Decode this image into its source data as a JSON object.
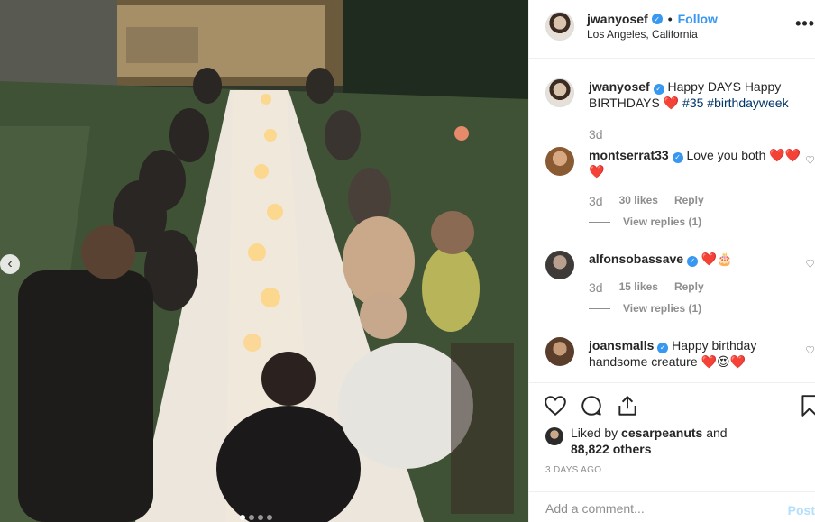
{
  "post": {
    "username": "jwanyosef",
    "follow_label": "Follow",
    "separator": "•",
    "location": "Los Angeles, California",
    "more_label": "•••"
  },
  "caption": {
    "username": "jwanyosef",
    "text_before": "Happy DAYS Happy BIRTHDAYS ❤️",
    "hashtags": "#35 #birthdayweek",
    "time": "3d"
  },
  "comments": [
    {
      "username": "montserrat33",
      "text": "Love you both ❤️❤️❤️",
      "time": "3d",
      "likes": "30 likes",
      "reply": "Reply",
      "view_replies": "View replies (1)"
    },
    {
      "username": "alfonsobassave",
      "text": "❤️🎂",
      "time": "3d",
      "likes": "15 likes",
      "reply": "Reply",
      "view_replies": "View replies (1)"
    },
    {
      "username": "joansmalls",
      "text": "Happy birthday handsome creature ❤️😍❤️"
    }
  ],
  "likes": {
    "prefix": "Liked by",
    "user": "cesarpeanuts",
    "joiner": "and",
    "others": "88,822 others"
  },
  "date": "3 DAYS AGO",
  "add_comment": {
    "placeholder": "Add a comment...",
    "post_label": "Post"
  },
  "carousel": {
    "prev_icon": "‹",
    "dot_count": 4,
    "active_index": 0
  },
  "colors": {
    "accent": "#3897f0",
    "text": "#262626",
    "muted": "#8e8e8e",
    "border": "#efefef",
    "post_disabled": "#b2dffc"
  }
}
